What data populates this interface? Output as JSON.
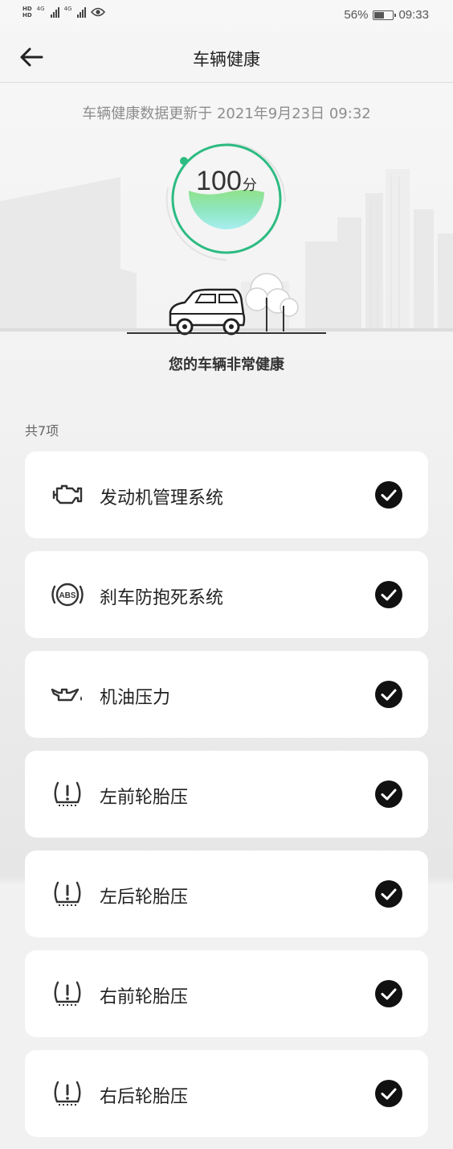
{
  "status_bar": {
    "battery": "56%",
    "time": "09:33",
    "network": "4G"
  },
  "header": {
    "title": "车辆健康"
  },
  "update_line": "车辆健康数据更新于  2021年9月23日 09:32",
  "score": {
    "value": "100",
    "unit": "分",
    "level": 1.0
  },
  "health_message": "您的车辆非常健康",
  "count_label": "共7项",
  "items": [
    {
      "label": "发动机管理系统",
      "icon": "engine-icon",
      "status": "ok"
    },
    {
      "label": "刹车防抱死系统",
      "icon": "abs-icon",
      "status": "ok"
    },
    {
      "label": "机油压力",
      "icon": "oil-pressure-icon",
      "status": "ok"
    },
    {
      "label": "左前轮胎压",
      "icon": "tire-pressure-icon",
      "status": "ok"
    },
    {
      "label": "左后轮胎压",
      "icon": "tire-pressure-icon",
      "status": "ok"
    },
    {
      "label": "右前轮胎压",
      "icon": "tire-pressure-icon",
      "status": "ok"
    },
    {
      "label": "右后轮胎压",
      "icon": "tire-pressure-icon",
      "status": "ok"
    }
  ],
  "colors": {
    "accent": "#2dbb82",
    "check": "#111111",
    "card": "#ffffff"
  }
}
